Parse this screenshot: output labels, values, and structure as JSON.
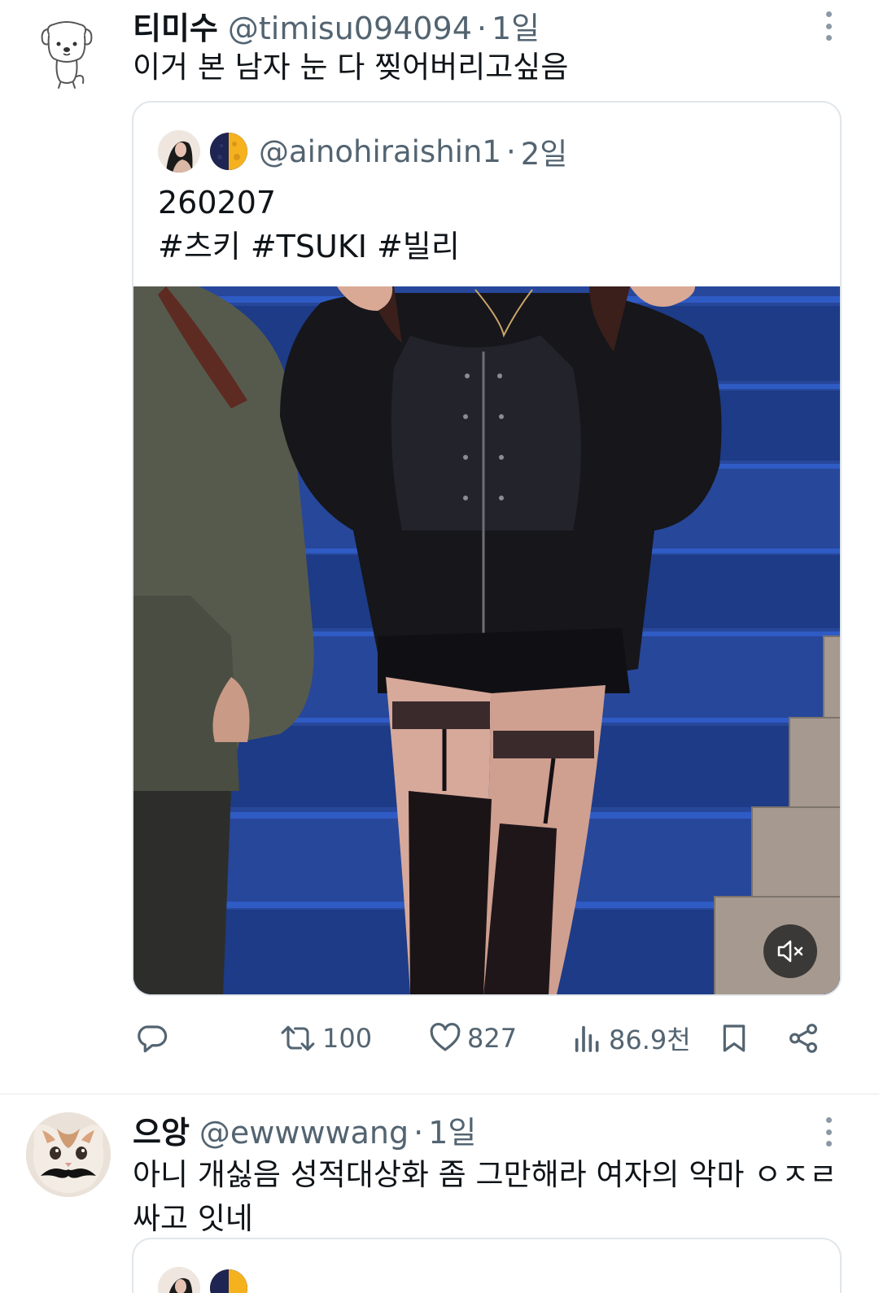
{
  "tweet1": {
    "display_name": "티미수",
    "handle": "@timisu094094",
    "separator": "·",
    "time": "1일",
    "text": "이거 본 남자 눈 다 찢어버리고싶음",
    "quote": {
      "handle": "@ainohiraishin1",
      "time": "2일",
      "text": "260207\n#츠키 #TSUKI #빌리",
      "media": {
        "type": "video",
        "muted": true,
        "colors": {
          "stairs": "#244a9a",
          "stair_edge": "#3a6ee0",
          "jacket": "#5b5d50",
          "outfit": "#121216",
          "skin": "#e6b7a5"
        }
      }
    },
    "actions": {
      "reply": {
        "icon": "reply-icon",
        "count": ""
      },
      "retweet": {
        "icon": "retweet-icon",
        "count": "100"
      },
      "like": {
        "icon": "heart-icon",
        "count": "827"
      },
      "views": {
        "icon": "views-icon",
        "count": "86.9천"
      },
      "bookmark": {
        "icon": "bookmark-icon"
      },
      "share": {
        "icon": "share-icon"
      }
    }
  },
  "tweet2": {
    "display_name": "으앙",
    "handle": "@ewwwwang",
    "separator": "·",
    "time": "1일",
    "text": "아니 개싫음 성적대상화 좀 그만해라 여자의 악마 ㅇㅈㄹ싸고 잇네"
  },
  "colors": {
    "text": "#0f1419",
    "secondary": "#536471",
    "border": "#e1e6ea",
    "divider": "#e6e9ec"
  }
}
